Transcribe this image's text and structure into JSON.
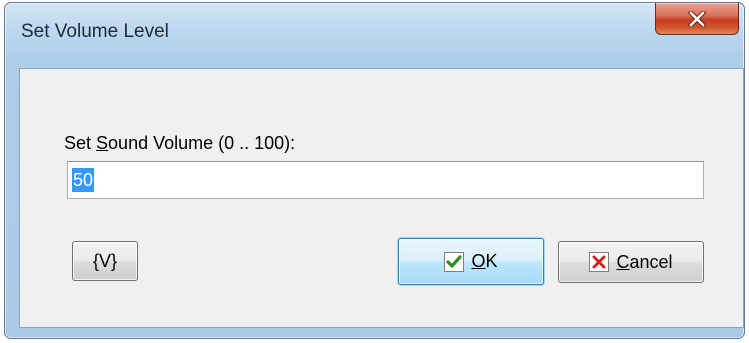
{
  "window": {
    "title": "Set Volume Level"
  },
  "form": {
    "label_prefix": "Set ",
    "label_mnemonic": "S",
    "label_rest": "ound Volume (0 .. 100):",
    "input_value": "50"
  },
  "buttons": {
    "variable_label": "{V}",
    "ok_mnemonic": "O",
    "ok_rest": "K",
    "cancel_mnemonic": "C",
    "cancel_rest": "ancel"
  },
  "icons": {
    "close": "close-icon",
    "ok": "checkmark-icon",
    "cancel": "x-icon"
  },
  "colors": {
    "close_button": "#c94a2c",
    "ok_check": "#2f8f1e",
    "cancel_x": "#d21f1f",
    "selection": "#3399ff"
  }
}
